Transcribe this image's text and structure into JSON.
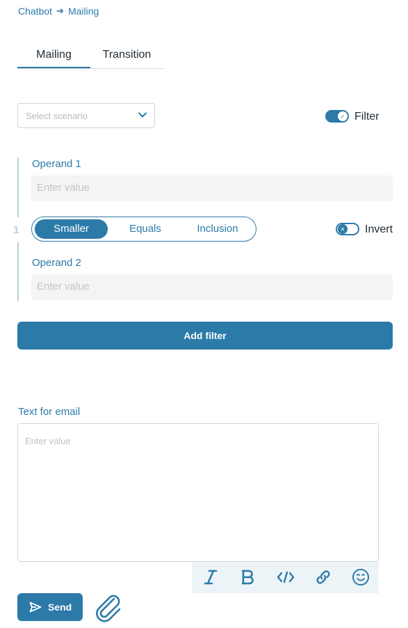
{
  "breadcrumb": {
    "root": "Chatbot",
    "current": "Mailing"
  },
  "tabs": [
    {
      "label": "Mailing",
      "active": true
    },
    {
      "label": "Transition",
      "active": false
    }
  ],
  "scenario": {
    "placeholder": "Select scenario"
  },
  "filter_toggle": {
    "label": "Filter",
    "on": true
  },
  "filter_group": {
    "number": "1",
    "operand1": {
      "label": "Operand 1",
      "placeholder": "Enter value"
    },
    "operand2": {
      "label": "Operand 2",
      "placeholder": "Enter value"
    },
    "operators": [
      "Smaller",
      "Equals",
      "Inclusion"
    ],
    "selected_operator": "Smaller",
    "invert": {
      "label": "Invert",
      "on": false
    }
  },
  "add_filter_label": "Add filter",
  "email": {
    "label": "Text for email",
    "placeholder": "Enter value"
  },
  "toolbar": [
    "italic-icon",
    "bold-icon",
    "code-icon",
    "link-icon",
    "emoji-icon"
  ],
  "send_label": "Send",
  "colors": {
    "accent": "#2b7aa8",
    "muted_line": "#b7cdd9",
    "input_bg": "#f4f4f4",
    "toolbar_bg": "#edf4f8"
  }
}
